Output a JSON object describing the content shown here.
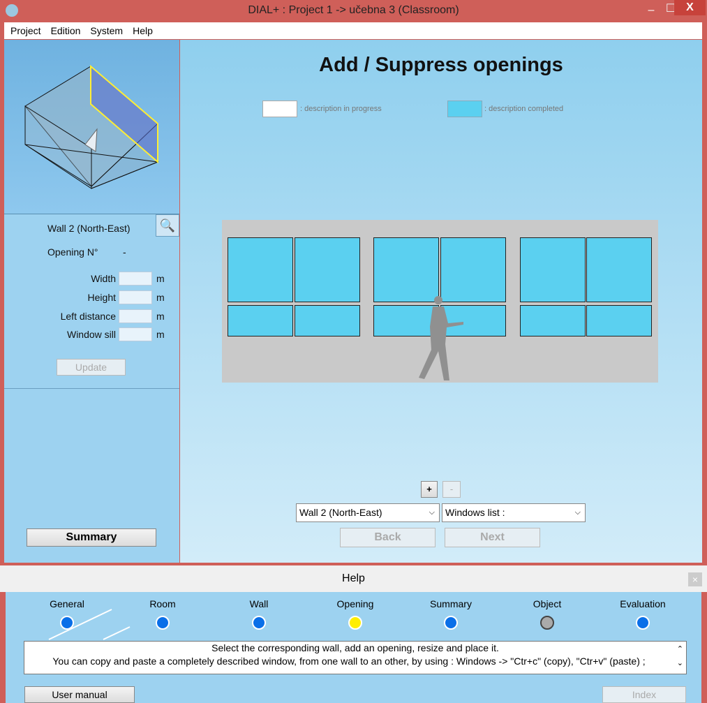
{
  "window": {
    "title": "DIAL+ : Project 1 -> učebna 3 (Classroom)",
    "minimize": "–",
    "maximize": "☐",
    "close": "X"
  },
  "menu": [
    "Project",
    "Edition",
    "System",
    "Help"
  ],
  "left": {
    "wall_label": "Wall 2 (North-East)",
    "opening_label": "Opening N°",
    "opening_value": "-",
    "fields": [
      {
        "label": "Width",
        "unit": "m",
        "value": ""
      },
      {
        "label": "Height",
        "unit": "m",
        "value": ""
      },
      {
        "label": "Left distance",
        "unit": "m",
        "value": ""
      },
      {
        "label": "Window sill",
        "unit": "m",
        "value": ""
      }
    ],
    "update": "Update",
    "summary": "Summary"
  },
  "main": {
    "title": "Add / Suppress openings",
    "legend_progress": ": description in progress",
    "legend_completed": ": description completed",
    "add": "+",
    "remove": "-",
    "wall_select": "Wall 2 (North-East)",
    "windows_select": "Windows list :",
    "back": "Back",
    "next": "Next"
  },
  "help": {
    "title": "Help",
    "close": "×",
    "steps": [
      {
        "label": "General",
        "state": "done"
      },
      {
        "label": "Room",
        "state": "done"
      },
      {
        "label": "Wall",
        "state": "done"
      },
      {
        "label": "Opening",
        "state": "current"
      },
      {
        "label": "Summary",
        "state": "done"
      },
      {
        "label": "Object",
        "state": "disabled"
      },
      {
        "label": "Evaluation",
        "state": "done"
      }
    ],
    "text_line1": "Select the corresponding wall, add an opening, resize and place it.",
    "text_line2": "You can copy and paste a completely described window, from one wall to an other, by using : Windows -> \"Ctr+c\" (copy), \"Ctr+v\" (paste) ;",
    "user_manual": "User manual",
    "index": "Index"
  },
  "colors": {
    "completed": "#5bd0f0",
    "current_step": "#ffee00",
    "step": "#0a6fe8"
  }
}
